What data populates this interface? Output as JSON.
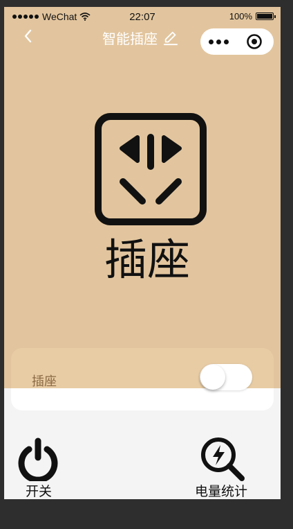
{
  "status_bar": {
    "carrier": "WeChat",
    "time": "22:07",
    "battery": "100%"
  },
  "nav": {
    "title": "智能插座"
  },
  "device": {
    "label": "插座"
  },
  "card": {
    "label": "插座",
    "toggle_on": false
  },
  "bottom": {
    "power_label": "开关",
    "stats_label": "电量统计"
  },
  "colors": {
    "background_tan": "#e2c59e",
    "page": "#f4f4f4",
    "frame": "#2e2e2e"
  }
}
